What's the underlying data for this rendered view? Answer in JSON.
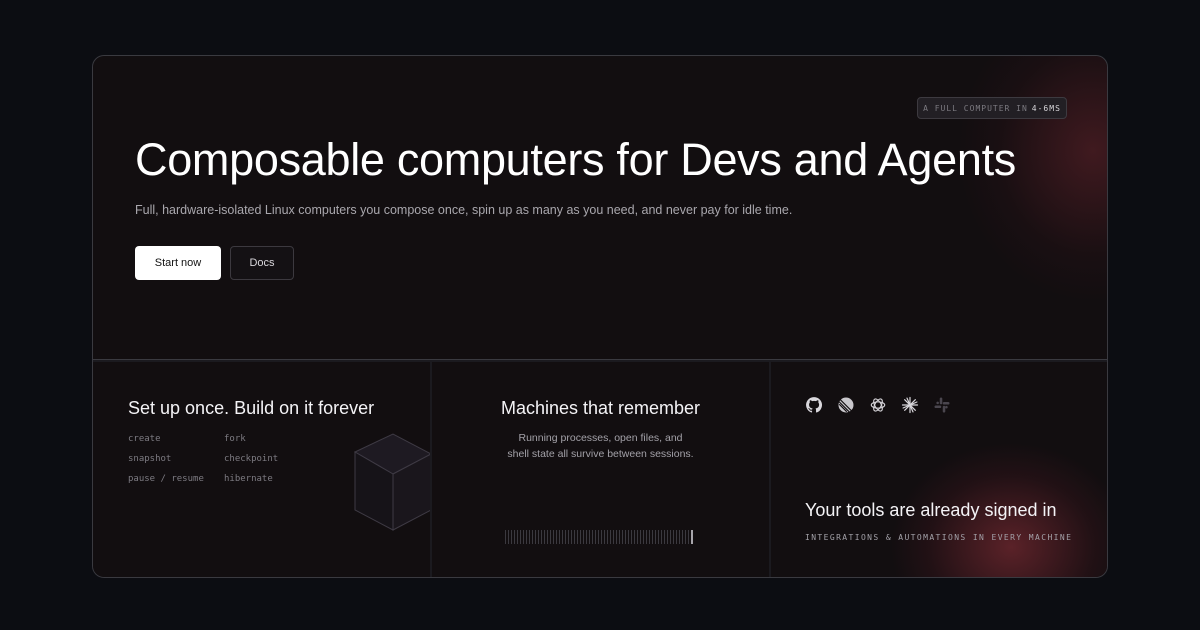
{
  "hero": {
    "badge_prefix": "A FULL COMPUTER IN",
    "badge_highlight": "4-6MS",
    "title": "Composable computers for Devs and Agents",
    "subtitle": "Full, hardware-isolated Linux computers you compose once, spin up as many as you need, and never pay for idle time.",
    "primary_button": "Start now",
    "secondary_button": "Docs"
  },
  "cards": {
    "setup": {
      "title": "Set up once. Build on it forever",
      "commands": [
        "create",
        "fork",
        "snapshot",
        "checkpoint",
        "pause / resume",
        "hibernate"
      ]
    },
    "memory": {
      "title": "Machines that remember",
      "description_line1": "Running processes, open files, and",
      "description_line2": "shell state all survive between sessions."
    },
    "tools": {
      "icons": [
        "github-icon",
        "linear-icon",
        "openai-icon",
        "claude-icon",
        "slack-icon"
      ],
      "title": "Your tools are already signed in",
      "subtitle": "INTEGRATIONS & AUTOMATIONS IN EVERY MACHINE"
    }
  },
  "colors": {
    "background": "#0c0d12",
    "card": "#120e10",
    "border": "#3a3a40",
    "accent_glow": "#96323c"
  }
}
